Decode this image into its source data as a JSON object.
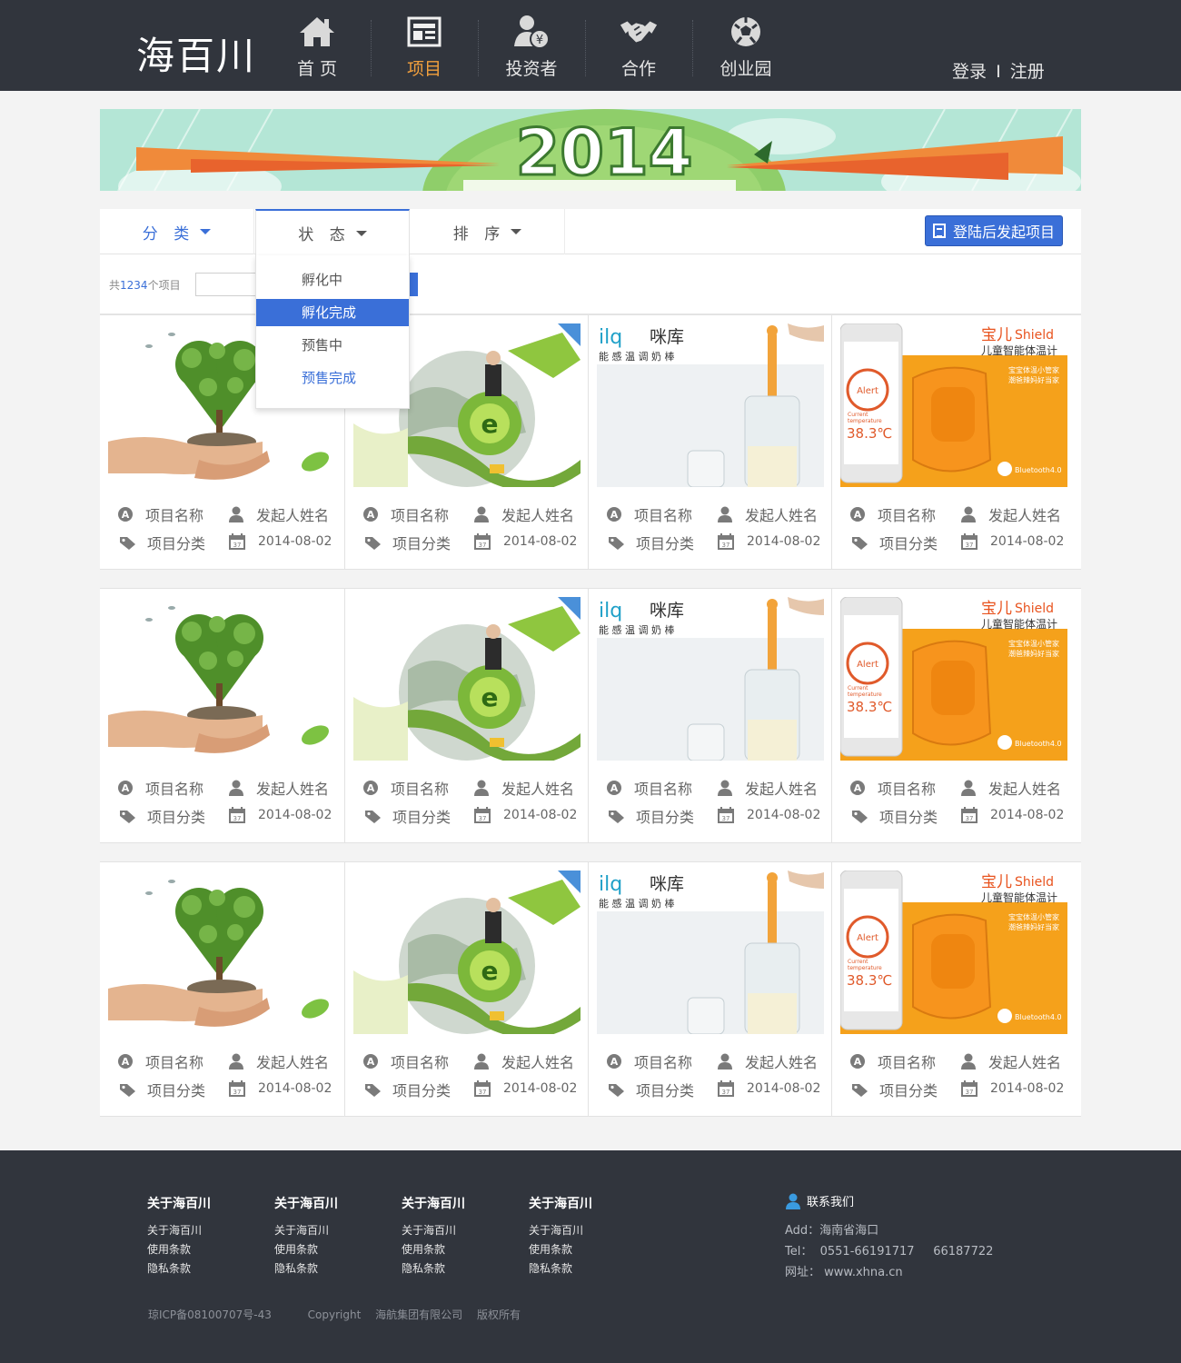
{
  "header": {
    "logo": "海百川",
    "nav": [
      {
        "label": "首 页",
        "icon": "home-icon"
      },
      {
        "label": "项目",
        "icon": "newspaper-icon",
        "active": true
      },
      {
        "label": "投资者",
        "icon": "investor-icon"
      },
      {
        "label": "合作",
        "icon": "handshake-icon"
      },
      {
        "label": "创业园",
        "icon": "soccer-ball-icon"
      }
    ],
    "login": "登录",
    "separator": "I",
    "register": "注册"
  },
  "banner": {
    "text": "2014"
  },
  "filters": {
    "category": "分 类",
    "status": "状 态",
    "sort": "排 序",
    "launch_button": "登陆后发起项目"
  },
  "subbar": {
    "count_prefix": "共",
    "count": "1234",
    "count_suffix": "个项目"
  },
  "status_dropdown": {
    "options": [
      "孵化中",
      "孵化完成",
      "预售中",
      "预售完成"
    ],
    "selected": "孵化完成"
  },
  "cards": {
    "project_name": "项目名称",
    "founder": "发起人姓名",
    "category": "项目分类",
    "date": "2014-08-02",
    "images": [
      {
        "type": "tree-heart"
      },
      {
        "type": "globe"
      },
      {
        "type": "milk",
        "brand_latin": "ilq",
        "brand": "咪库",
        "tagline": "能 感 温 调 奶 棒"
      },
      {
        "type": "shield",
        "brand_cn": "宝儿",
        "brand_en": "Shield",
        "subtitle": "儿童智能体温计",
        "line1": "宝宝体温小管家",
        "line2": "潮爸辣妈好当家",
        "alert": "Alert",
        "current_label": "Current",
        "temperature_label": "temperature",
        "temperature": "38.3℃",
        "bluetooth": "Bluetooth4.0"
      }
    ]
  },
  "footer": {
    "columns": [
      {
        "title": "关于海百川",
        "links": [
          "关于海百川",
          "使用条款",
          "隐私条款"
        ]
      },
      {
        "title": "关于海百川",
        "links": [
          "关于海百川",
          "使用条款",
          "隐私条款"
        ]
      },
      {
        "title": "关于海百川",
        "links": [
          "关于海百川",
          "使用条款",
          "隐私条款"
        ]
      },
      {
        "title": "关于海百川",
        "links": [
          "关于海百川",
          "使用条款",
          "隐私条款"
        ]
      }
    ],
    "contact_title": "联系我们",
    "contact_lines": [
      "Add：海南省海口",
      "Tel：  0551-66191717     66187722",
      "网址： www.xhna.cn"
    ],
    "icp": "琼ICP备08100707号-43",
    "copyright": "Copyright",
    "company": "海航集团有限公司",
    "rights": "版权所有"
  },
  "colors": {
    "header_bg": "#31353d",
    "accent_blue": "#3a6fd8",
    "active_orange": "#f2a03d"
  }
}
